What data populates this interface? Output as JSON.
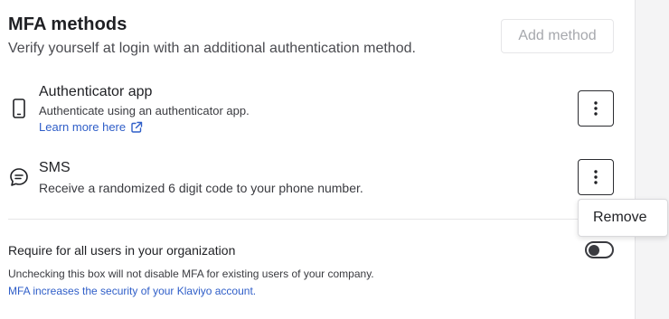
{
  "header": {
    "title": "MFA methods",
    "subtitle": "Verify yourself at login with an additional authentication method.",
    "add_button_label": "Add method"
  },
  "methods": [
    {
      "name": "Authenticator app",
      "description": "Authenticate using an authenticator app.",
      "link_text": "Learn more here",
      "icon": "phone-icon"
    },
    {
      "name": "SMS",
      "description": "Receive a randomized 6 digit code to your phone number.",
      "icon": "chat-bubble-icon"
    }
  ],
  "menu": {
    "remove_label": "Remove"
  },
  "org_requirement": {
    "label": "Require for all users in your organization",
    "enabled": false,
    "note": "Unchecking this box will not disable MFA for existing users of your company.",
    "link_text": "MFA increases the security of your Klaviyo account."
  },
  "colors": {
    "link": "#2f5ec8",
    "text": "#1f2024",
    "disabled_text": "#a6a8ad",
    "border": "#2b2c30"
  }
}
